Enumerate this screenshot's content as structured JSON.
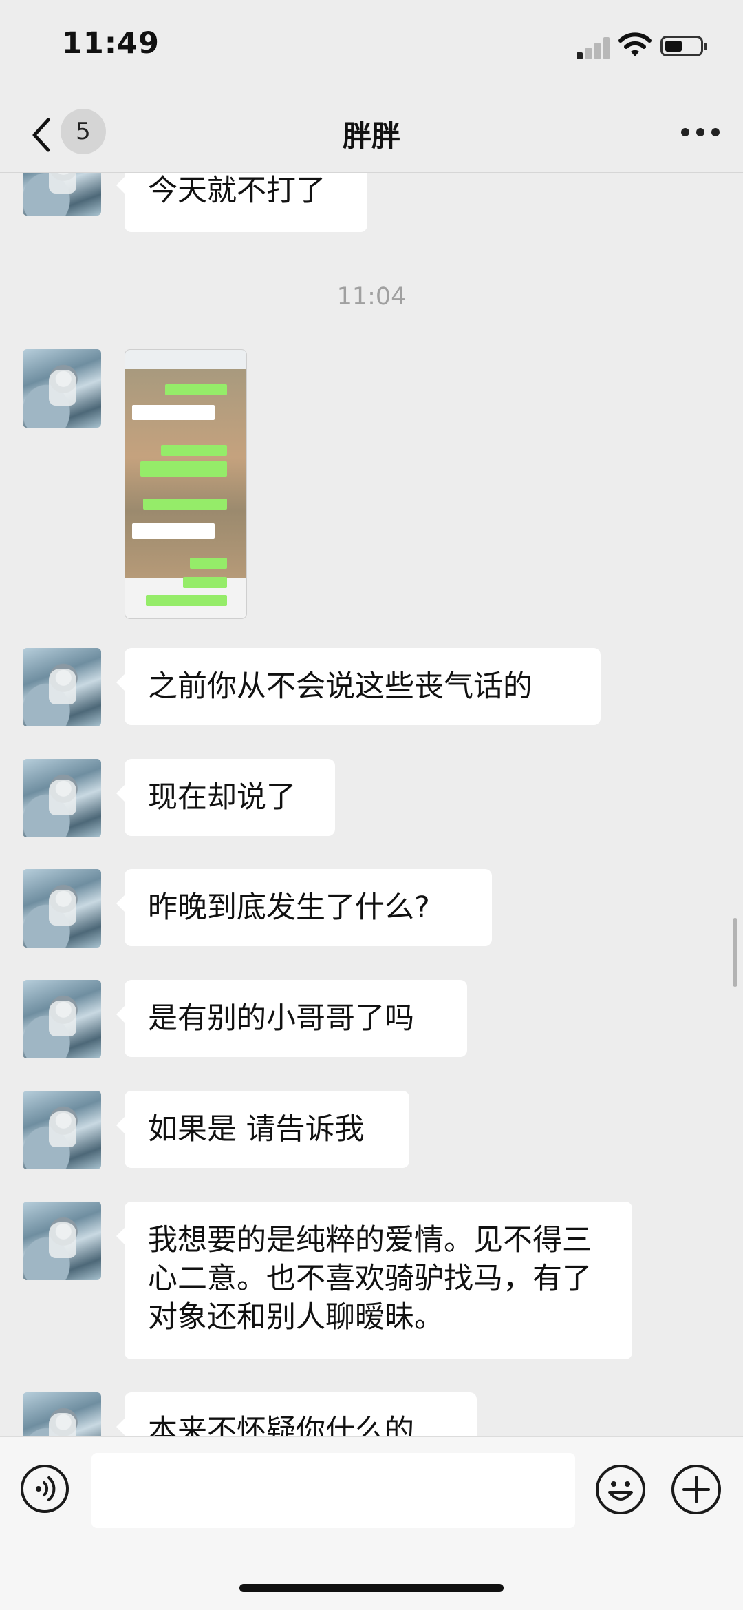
{
  "status_bar": {
    "time": "11:49"
  },
  "nav": {
    "back_badge": "5",
    "title": "胖胖"
  },
  "messages": [
    {
      "type": "text",
      "text": "今天就不打了"
    },
    {
      "type": "timestamp",
      "text": "11:04"
    },
    {
      "type": "image",
      "text": ""
    },
    {
      "type": "text",
      "text": "之前你从不会说这些丧气话的"
    },
    {
      "type": "text",
      "text": "现在却说了"
    },
    {
      "type": "text",
      "text": "昨晚到底发生了什么?"
    },
    {
      "type": "text",
      "text": "是有别的小哥哥了吗"
    },
    {
      "type": "text",
      "text": "如果是 请告诉我"
    },
    {
      "type": "text",
      "text": "我想要的是纯粹的爱情。见不得三心二意。也不喜欢骑驴找马，有了对象还和别人聊暧昧。"
    },
    {
      "type": "text",
      "text": "本来不怀疑你什么的"
    }
  ]
}
